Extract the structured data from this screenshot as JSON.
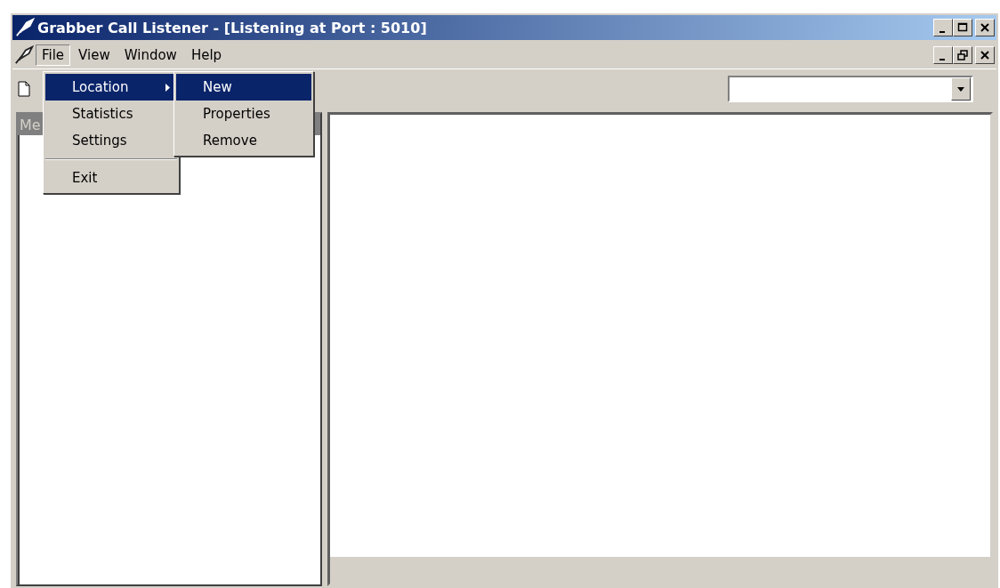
{
  "window": {
    "title": "Grabber Call Listener - [Listening at Port : 5010]"
  },
  "menu_bar": [
    {
      "label": "File",
      "selected": true
    },
    {
      "label": "View",
      "selected": false
    },
    {
      "label": "Window",
      "selected": false
    },
    {
      "label": "Help",
      "selected": false
    }
  ],
  "file_menu": [
    {
      "kind": "submenu",
      "label": "Location",
      "selected": true
    },
    {
      "kind": "item",
      "label": "Statistics",
      "selected": false
    },
    {
      "kind": "item",
      "label": "Settings",
      "selected": false
    },
    {
      "kind": "separator"
    },
    {
      "kind": "item",
      "label": "Exit",
      "selected": false
    }
  ],
  "location_submenu": [
    {
      "label": "New",
      "selected": true
    },
    {
      "label": "Properties",
      "selected": false
    },
    {
      "label": "Remove",
      "selected": false
    }
  ],
  "left_panel": {
    "title": "Me"
  }
}
